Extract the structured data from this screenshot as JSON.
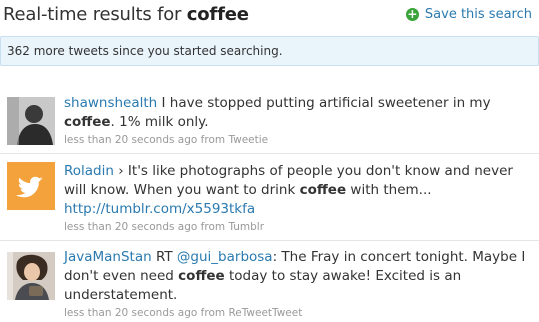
{
  "header": {
    "title_prefix": "Real-time results for",
    "query": "coffee",
    "save_label": "Save this search"
  },
  "banner": {
    "text": "362 more tweets since you started searching."
  },
  "tweets": [
    {
      "user": "shawnshealth",
      "text_before": " I have stopped putting artificial sweetener in my",
      "highlight": "coffee",
      "text_after": ". 1% milk only.",
      "meta": "less than 20 seconds ago from Tweetie"
    },
    {
      "user": "Roladin",
      "text_before": " › It's like photographs of people you don't know and never will know. When you want to drink ",
      "highlight": "coffee",
      "text_after": " with them...",
      "link": "http://tumblr.com/x5593tkfa",
      "meta": "less than 20 seconds ago from Tumblr"
    },
    {
      "user": "JavaManStan",
      "rt": " RT ",
      "mention": "@gui_barbosa",
      "text_before": ": The Fray in concert tonight. Maybe I don't even need ",
      "highlight": "coffee",
      "text_after": " today to stay awake! Excited is an understatement.",
      "meta": "less than 20 seconds ago from ReTweetTweet"
    }
  ],
  "colors": {
    "link": "#2a7ab0",
    "banner_bg": "#eaf4fb",
    "twitter_bg": "#f4a23c"
  }
}
